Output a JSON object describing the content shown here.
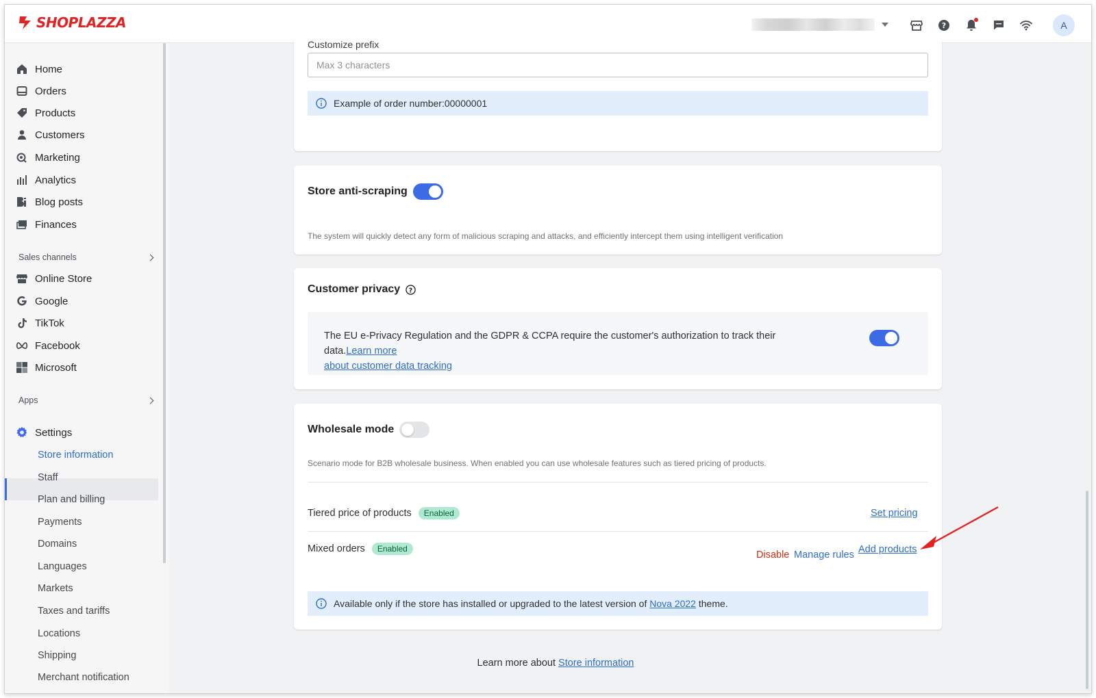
{
  "brand": {
    "name": "SHOPLAZZA",
    "color": "#e02424"
  },
  "topbar": {
    "icons": [
      "store-icon",
      "help-icon",
      "bell-icon",
      "chat-icon",
      "wifi-icon"
    ],
    "avatar_letter": "A"
  },
  "sidebar": {
    "items": [
      {
        "label": "Home",
        "icon": "home-icon"
      },
      {
        "label": "Orders",
        "icon": "orders-icon"
      },
      {
        "label": "Products",
        "icon": "tag-icon"
      },
      {
        "label": "Customers",
        "icon": "person-icon"
      },
      {
        "label": "Marketing",
        "icon": "marketing-icon"
      },
      {
        "label": "Analytics",
        "icon": "bar-chart-icon"
      },
      {
        "label": "Blog posts",
        "icon": "blog-icon"
      },
      {
        "label": "Finances",
        "icon": "finance-icon"
      }
    ],
    "sales_channels_label": "Sales channels",
    "channels": [
      {
        "label": "Online Store",
        "icon": "store-icon"
      },
      {
        "label": "Google",
        "icon": "google-icon"
      },
      {
        "label": "TikTok",
        "icon": "tiktok-icon"
      },
      {
        "label": "Facebook",
        "icon": "meta-icon"
      },
      {
        "label": "Microsoft",
        "icon": "microsoft-icon"
      }
    ],
    "apps_label": "Apps",
    "settings_label": "Settings",
    "settings_items": [
      "Store information",
      "Staff",
      "Plan and billing",
      "Payments",
      "Domains",
      "Languages",
      "Markets",
      "Taxes and tariffs",
      "Locations",
      "Shipping",
      "Merchant notification"
    ],
    "active_settings_item": "Store information"
  },
  "prefix_card": {
    "label": "Customize prefix",
    "placeholder": "Max 3 characters",
    "example": "Example of order number:00000001"
  },
  "anti_scraping": {
    "title": "Store anti-scraping",
    "enabled": true,
    "description": "The system will quickly detect any form of malicious scraping and attacks, and efficiently intercept them using intelligent verification"
  },
  "privacy": {
    "title": "Customer privacy",
    "text": "The EU e-Privacy Regulation and the GDPR & CCPA require the customer's authorization to track their data.",
    "link_text_1": "Learn more",
    "link_text_2": "about customer data tracking",
    "enabled": true
  },
  "wholesale": {
    "title": "Wholesale mode",
    "enabled": false,
    "description": "Scenario mode for B2B wholesale business. When enabled you can use wholesale features such as tiered pricing of products.",
    "tiered": {
      "label": "Tiered price of products",
      "badge": "Enabled",
      "action": "Set pricing"
    },
    "mixed": {
      "label": "Mixed orders",
      "badge": "Enabled",
      "disable": "Disable",
      "manage": "Manage rules",
      "add": "Add products"
    },
    "note_prefix": "Available only if the store has installed or upgraded to the latest version of ",
    "note_link": "Nova 2022",
    "note_suffix": " theme."
  },
  "footer": {
    "prefix": "Learn more about ",
    "link": "Store information"
  },
  "colors": {
    "accent": "#3d6ae5",
    "link": "#2c6ecb",
    "danger": "#d72c0d",
    "badge_bg": "#aee9d1",
    "annotation_arrow": "#e02424"
  }
}
